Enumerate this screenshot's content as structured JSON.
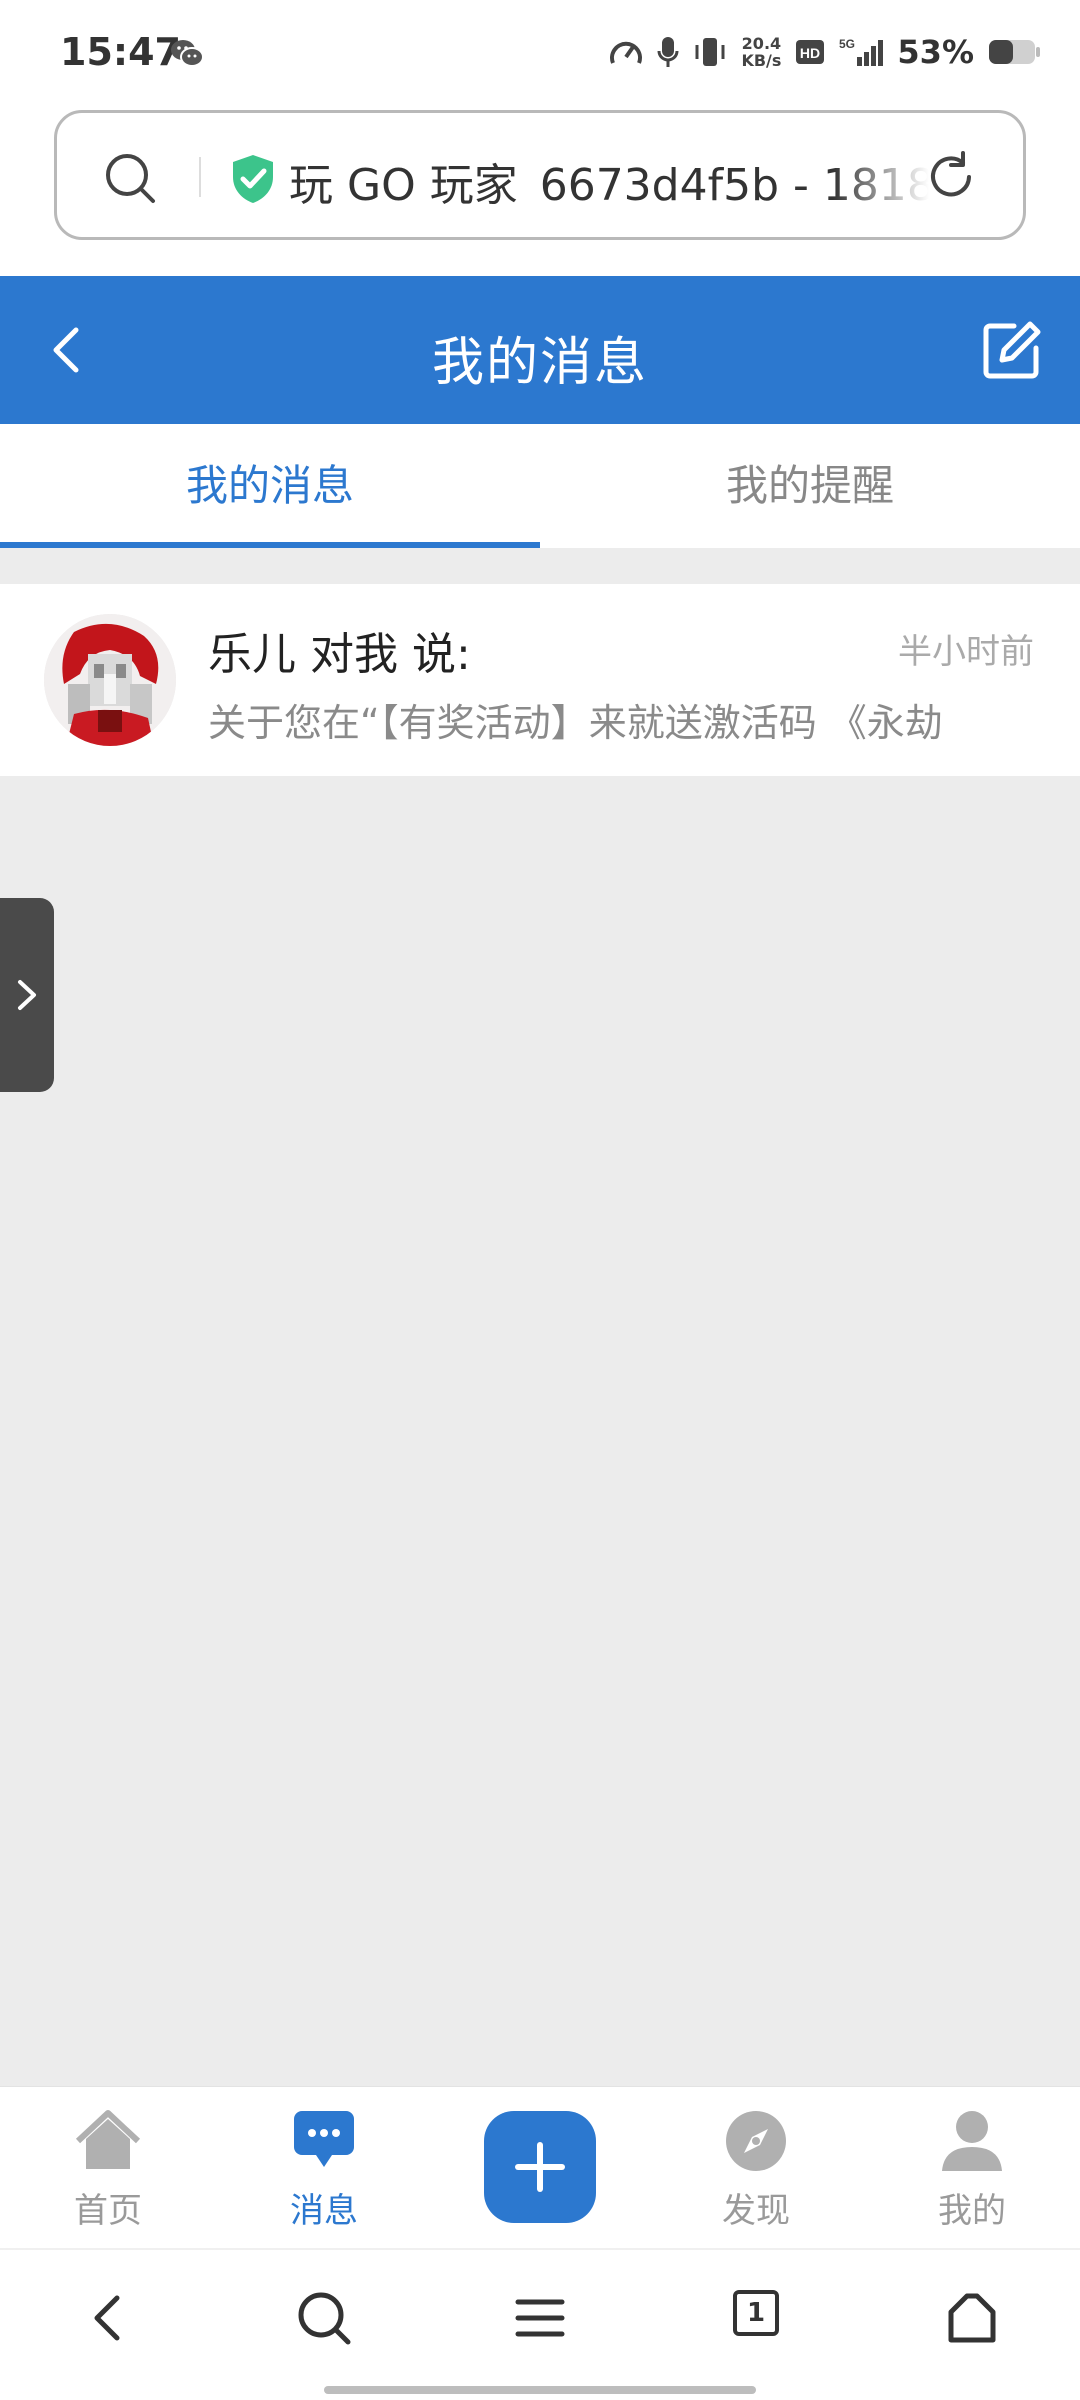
{
  "status_bar": {
    "time": "15:47",
    "net_speed_value": "20.4",
    "net_speed_unit": "KB/s",
    "hd_label": "HD",
    "network_label": "5G",
    "battery_percent": "53%",
    "battery_level": 0.53,
    "icons": [
      "wechat-icon",
      "speedometer-icon",
      "mic-icon",
      "vibrate-icon",
      "hd-icon",
      "signal-icon",
      "battery-icon"
    ]
  },
  "address_bar": {
    "text": "玩 GO 玩家_6673d4f5b - 1818",
    "icons": [
      "search-icon",
      "shield-check-icon",
      "reload-icon"
    ]
  },
  "header": {
    "title": "我的消息",
    "icons": [
      "back-icon",
      "compose-icon"
    ]
  },
  "tabs": [
    {
      "label": "我的消息",
      "active": true
    },
    {
      "label": "我的提醒",
      "active": false
    }
  ],
  "messages": [
    {
      "title": "乐儿 对我 说:",
      "time": "半小时前",
      "preview": "关于您在“【有奖活动】来就送激活码 《永劫"
    }
  ],
  "bottom_tabs": [
    {
      "label": "首页",
      "icon": "home-icon",
      "active": false
    },
    {
      "label": "消息",
      "icon": "chat-icon",
      "active": true
    },
    {
      "label": "",
      "icon": "plus-icon",
      "active": false
    },
    {
      "label": "发现",
      "icon": "compass-icon",
      "active": false
    },
    {
      "label": "我的",
      "icon": "user-icon",
      "active": false
    }
  ],
  "browser_nav": {
    "tab_count": "1",
    "icons": [
      "nav-back-icon",
      "nav-search-icon",
      "menu-icon",
      "tabs-icon",
      "home-outline-icon"
    ]
  },
  "colors": {
    "accent": "#2c78cf",
    "background": "#ececec",
    "muted_text": "#8a8a8a"
  }
}
